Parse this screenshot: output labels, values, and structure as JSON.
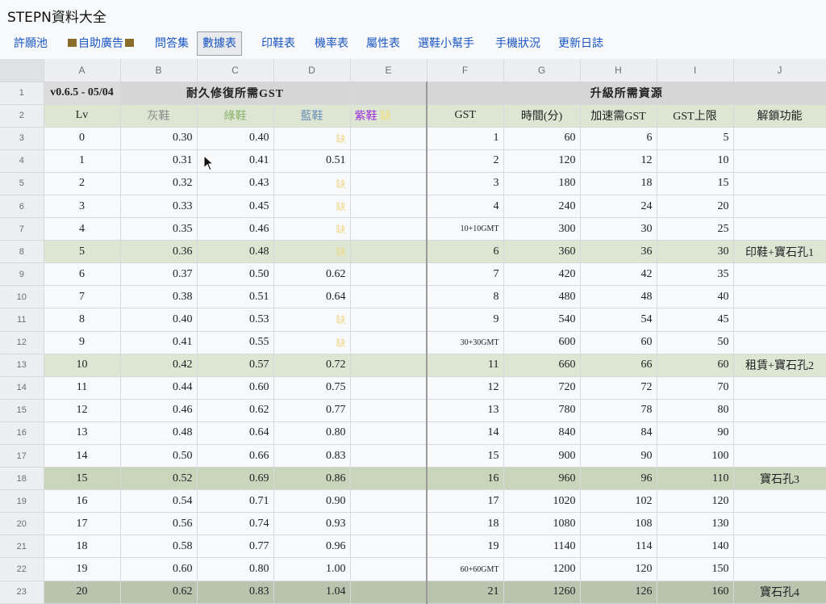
{
  "app": {
    "title": "STEPN資料大全"
  },
  "tabs": [
    {
      "label": "許願池",
      "active": false
    },
    {
      "label": "自助廣告",
      "active": false,
      "decorated": true
    },
    {
      "label": "問答集",
      "active": false
    },
    {
      "label": "數據表",
      "active": true
    },
    {
      "label": "印鞋表",
      "active": false
    },
    {
      "label": "機率表",
      "active": false
    },
    {
      "label": "屬性表",
      "active": false
    },
    {
      "label": "選鞋小幫手",
      "active": false
    },
    {
      "label": "手機狀況",
      "active": false
    },
    {
      "label": "更新日誌",
      "active": false
    }
  ],
  "columns": [
    "A",
    "B",
    "C",
    "D",
    "E",
    "F",
    "G",
    "H",
    "I",
    "J"
  ],
  "sheet": {
    "version": "v0.6.5 - 05/04",
    "repair_title": "耐久修復所需GST",
    "upgrade_title": "升級所需資源",
    "headers": {
      "lv": "Lv",
      "grey": "灰鞋",
      "green": "綠鞋",
      "blue": "藍鞋",
      "purple": "紫鞋",
      "gst": "GST",
      "time": "時間(分)",
      "speedup": "加速需GST",
      "cap": "GST上限",
      "unlock": "解鎖功能"
    },
    "missing_mark": "缺",
    "rows": [
      {
        "r": "3",
        "lv": "0",
        "b": "0.30",
        "c": "0.40",
        "d": "缺",
        "f": "1",
        "g": "60",
        "h": "6",
        "i": "5",
        "j": "",
        "hl": ""
      },
      {
        "r": "4",
        "lv": "1",
        "b": "0.31",
        "c": "0.41",
        "d": "0.51",
        "f": "2",
        "g": "120",
        "h": "12",
        "i": "10",
        "j": "",
        "hl": ""
      },
      {
        "r": "5",
        "lv": "2",
        "b": "0.32",
        "c": "0.43",
        "d": "缺",
        "f": "3",
        "g": "180",
        "h": "18",
        "i": "15",
        "j": "",
        "hl": ""
      },
      {
        "r": "6",
        "lv": "3",
        "b": "0.33",
        "c": "0.45",
        "d": "缺",
        "f": "4",
        "g": "240",
        "h": "24",
        "i": "20",
        "j": "",
        "hl": ""
      },
      {
        "r": "7",
        "lv": "4",
        "b": "0.35",
        "c": "0.46",
        "d": "缺",
        "f": "10+10GMT",
        "g": "300",
        "h": "30",
        "i": "25",
        "j": "",
        "hl": ""
      },
      {
        "r": "8",
        "lv": "5",
        "b": "0.36",
        "c": "0.48",
        "d": "缺",
        "f": "6",
        "g": "360",
        "h": "36",
        "i": "30",
        "j": "印鞋+寶石孔1",
        "hl": "hl"
      },
      {
        "r": "9",
        "lv": "6",
        "b": "0.37",
        "c": "0.50",
        "d": "0.62",
        "f": "7",
        "g": "420",
        "h": "42",
        "i": "35",
        "j": "",
        "hl": ""
      },
      {
        "r": "10",
        "lv": "7",
        "b": "0.38",
        "c": "0.51",
        "d": "0.64",
        "f": "8",
        "g": "480",
        "h": "48",
        "i": "40",
        "j": "",
        "hl": ""
      },
      {
        "r": "11",
        "lv": "8",
        "b": "0.40",
        "c": "0.53",
        "d": "缺",
        "f": "9",
        "g": "540",
        "h": "54",
        "i": "45",
        "j": "",
        "hl": ""
      },
      {
        "r": "12",
        "lv": "9",
        "b": "0.41",
        "c": "0.55",
        "d": "缺",
        "f": "30+30GMT",
        "g": "600",
        "h": "60",
        "i": "50",
        "j": "",
        "hl": ""
      },
      {
        "r": "13",
        "lv": "10",
        "b": "0.42",
        "c": "0.57",
        "d": "0.72",
        "f": "11",
        "g": "660",
        "h": "66",
        "i": "60",
        "j": "租賃+寶石孔2",
        "hl": "hl"
      },
      {
        "r": "14",
        "lv": "11",
        "b": "0.44",
        "c": "0.60",
        "d": "0.75",
        "f": "12",
        "g": "720",
        "h": "72",
        "i": "70",
        "j": "",
        "hl": ""
      },
      {
        "r": "15",
        "lv": "12",
        "b": "0.46",
        "c": "0.62",
        "d": "0.77",
        "f": "13",
        "g": "780",
        "h": "78",
        "i": "80",
        "j": "",
        "hl": ""
      },
      {
        "r": "16",
        "lv": "13",
        "b": "0.48",
        "c": "0.64",
        "d": "0.80",
        "f": "14",
        "g": "840",
        "h": "84",
        "i": "90",
        "j": "",
        "hl": ""
      },
      {
        "r": "17",
        "lv": "14",
        "b": "0.50",
        "c": "0.66",
        "d": "0.83",
        "f": "15",
        "g": "900",
        "h": "90",
        "i": "100",
        "j": "",
        "hl": ""
      },
      {
        "r": "18",
        "lv": "15",
        "b": "0.52",
        "c": "0.69",
        "d": "0.86",
        "f": "16",
        "g": "960",
        "h": "96",
        "i": "110",
        "j": "寶石孔3",
        "hl": "hl2"
      },
      {
        "r": "19",
        "lv": "16",
        "b": "0.54",
        "c": "0.71",
        "d": "0.90",
        "f": "17",
        "g": "1020",
        "h": "102",
        "i": "120",
        "j": "",
        "hl": ""
      },
      {
        "r": "20",
        "lv": "17",
        "b": "0.56",
        "c": "0.74",
        "d": "0.93",
        "f": "18",
        "g": "1080",
        "h": "108",
        "i": "130",
        "j": "",
        "hl": ""
      },
      {
        "r": "21",
        "lv": "18",
        "b": "0.58",
        "c": "0.77",
        "d": "0.96",
        "f": "19",
        "g": "1140",
        "h": "114",
        "i": "140",
        "j": "",
        "hl": ""
      },
      {
        "r": "22",
        "lv": "19",
        "b": "0.60",
        "c": "0.80",
        "d": "1.00",
        "f": "60+60GMT",
        "g": "1200",
        "h": "120",
        "i": "150",
        "j": "",
        "hl": ""
      },
      {
        "r": "23",
        "lv": "20",
        "b": "0.62",
        "c": "0.83",
        "d": "1.04",
        "f": "21",
        "g": "1260",
        "h": "126",
        "i": "160",
        "j": "寶石孔4",
        "hl": "hl3"
      }
    ]
  }
}
